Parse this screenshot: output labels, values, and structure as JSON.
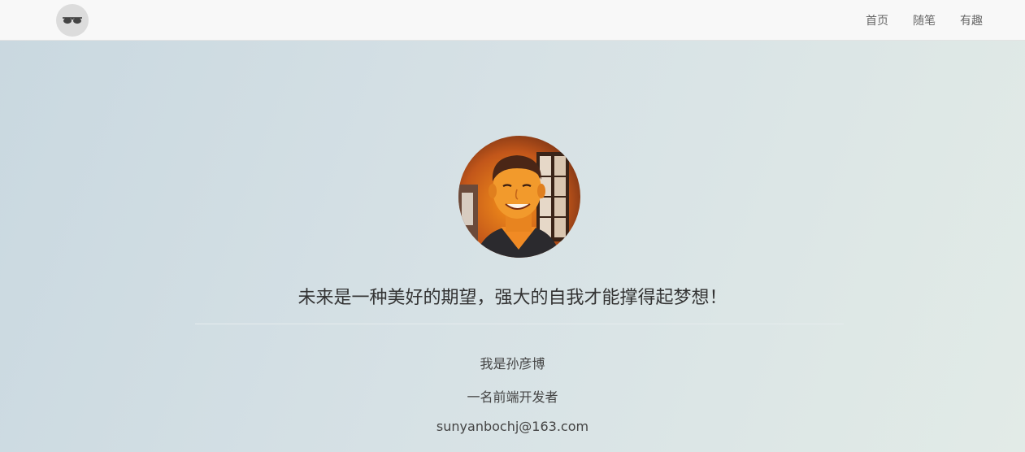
{
  "navbar": {
    "logo_icon": "glasses-icon",
    "links": [
      {
        "label": "首页"
      },
      {
        "label": "随笔"
      },
      {
        "label": "有趣"
      }
    ]
  },
  "profile": {
    "avatar_icon": "profile-photo",
    "headline": "未来是一种美好的期望，强大的自我才能撑得起梦想！",
    "name_line": "我是孙彦博",
    "role_line": "一名前端开发者",
    "email": "sunyanbochj@163.com"
  },
  "colors": {
    "navbar_bg": "#f8f8f8",
    "nav_text": "#666666",
    "headline_text": "#333333"
  }
}
